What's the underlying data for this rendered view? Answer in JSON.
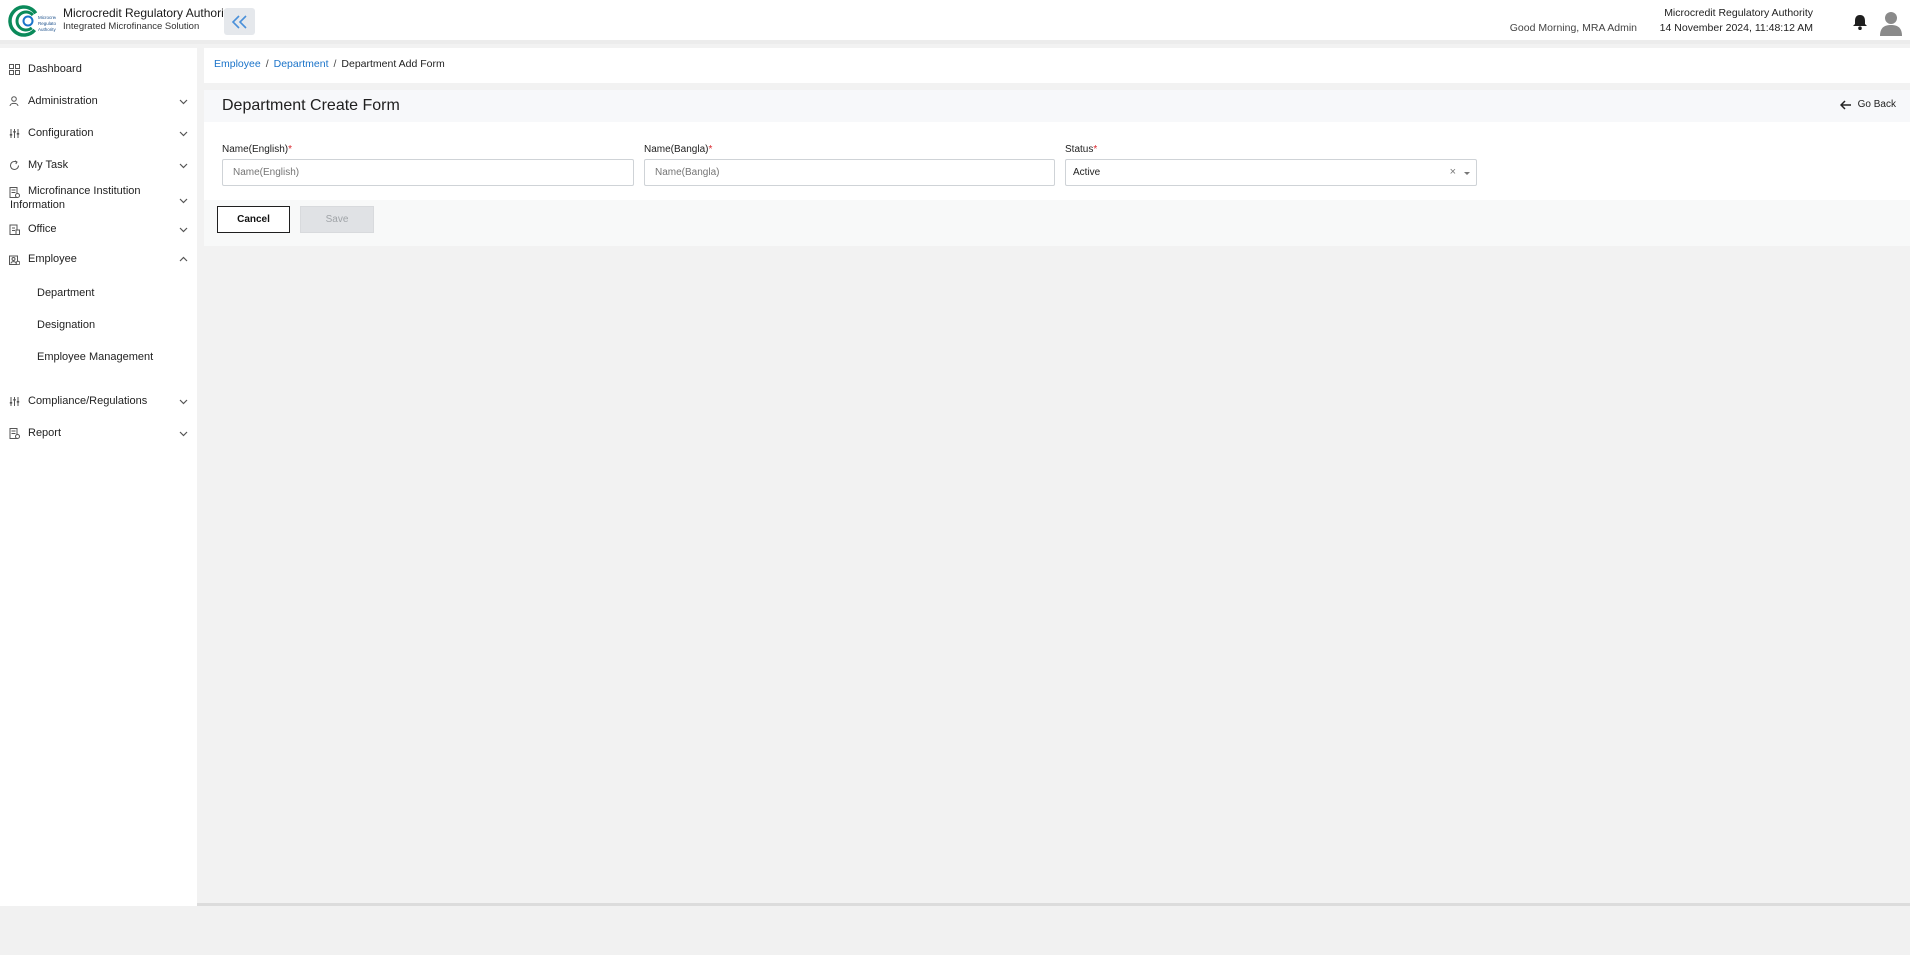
{
  "header": {
    "brand_title": "Microcredit Regulatory Authority",
    "brand_subtitle": "Integrated Microfinance Solution",
    "logo_text": "Microcredit Regulatory Authority",
    "greeting": "Good Morning, MRA Admin",
    "org_name": "Microcredit Regulatory Authority",
    "datetime": "14 November 2024, 11:48:12 AM",
    "accent_color": "#1a73c9",
    "logo_color": "#0a8a5a"
  },
  "sidebar": {
    "items": [
      {
        "label": "Dashboard",
        "icon": "grid-icon"
      },
      {
        "label": "Administration",
        "icon": "users-icon"
      },
      {
        "label": "Configuration",
        "icon": "sliders-icon"
      },
      {
        "label": "My Task",
        "icon": "refresh-icon"
      },
      {
        "label": "Microfinance Institution",
        "label2": "Information",
        "icon": "document-icon"
      },
      {
        "label": "Office",
        "icon": "building-icon"
      },
      {
        "label": "Employee",
        "icon": "employee-icon"
      },
      {
        "label": "Compliance/Regulations",
        "icon": "sliders-icon"
      },
      {
        "label": "Report",
        "icon": "report-icon"
      }
    ],
    "employee_sub": [
      "Department",
      "Designation",
      "Employee Management"
    ]
  },
  "breadcrumb": {
    "items": [
      "Employee",
      "Department"
    ],
    "separator": "/",
    "current": "Department Add Form"
  },
  "page": {
    "title": "Department Create Form",
    "go_back": "Go Back"
  },
  "form": {
    "name_en": {
      "label": "Name(English)",
      "placeholder": "Name(English)",
      "value": ""
    },
    "name_bn": {
      "label": "Name(Bangla)",
      "placeholder": "Name(Bangla)",
      "value": ""
    },
    "status": {
      "label": "Status",
      "value": "Active",
      "clear": "×"
    },
    "required_mark": "*",
    "cancel_label": "Cancel",
    "save_label": "Save"
  }
}
